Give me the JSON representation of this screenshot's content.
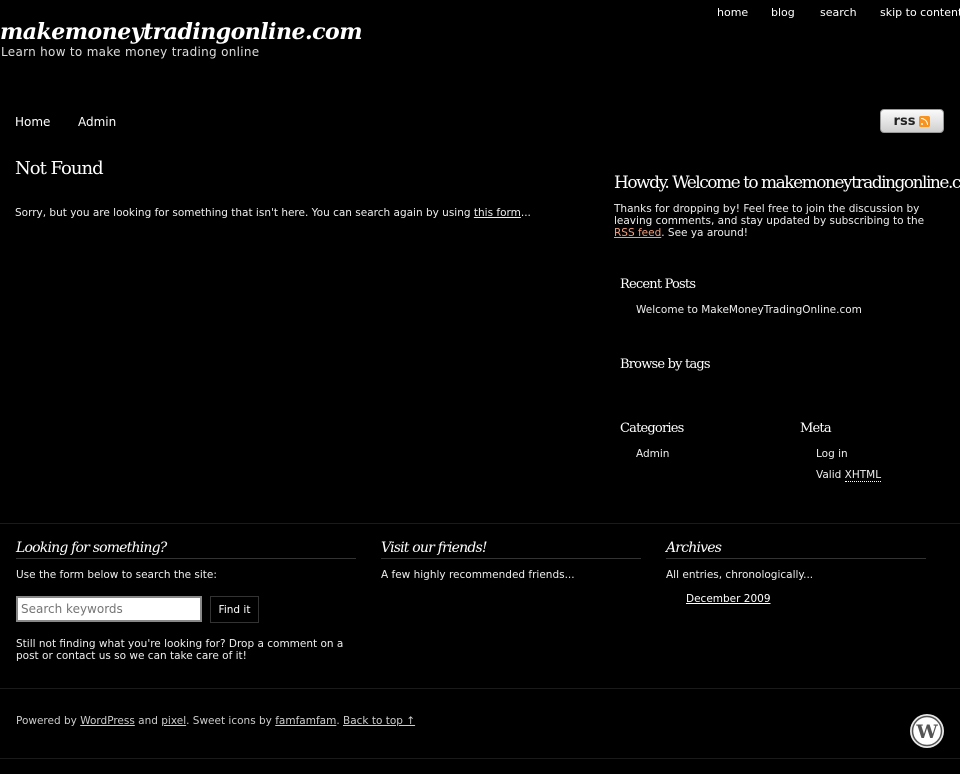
{
  "top_links": {
    "home": "home",
    "blog": "blog",
    "search": "search",
    "skip": "skip to content ↓"
  },
  "header": {
    "title": "makemoneytradingonline.com",
    "description": "Learn how to make money trading online"
  },
  "nav": {
    "home": "Home",
    "admin": "Admin",
    "rss_label": "rss"
  },
  "main": {
    "title": "Not Found",
    "text_before": "Sorry, but you are looking for something that isn't here. You can search again by using ",
    "link": "this form",
    "text_after": "..."
  },
  "sidebar": {
    "welcome_title": "Howdy. Welcome to makemoneytradingonline.com!",
    "intro_before": "Thanks for dropping by! Feel free to join the discussion by leaving comments, and stay updated by subscribing to the ",
    "intro_link": "RSS feed",
    "intro_after": ". See ya around!",
    "recent_posts_title": "Recent Posts",
    "recent_posts": [
      "Welcome to MakeMoneyTradingOnline.com"
    ],
    "tags_title": "Browse by tags",
    "categories_title": "Categories",
    "categories": [
      "Admin"
    ],
    "meta_title": "Meta",
    "meta_login": "Log in",
    "meta_valid": "Valid ",
    "meta_xhtml": "XHTML"
  },
  "footer_widgets": {
    "search_title": "Looking for something?",
    "search_intro": "Use the form below to search the site:",
    "search_placeholder": "Search keywords",
    "search_button": "Find it",
    "search_help": "Still not finding what you're looking for? Drop a comment on a post or contact us so we can take care of it!",
    "friends_title": "Visit our friends!",
    "friends_text": "A few highly recommended friends...",
    "archives_title": "Archives",
    "archives_text": "All entries, chronologically...",
    "archive_link": "December 2009"
  },
  "footer": {
    "powered_by": "Powered by ",
    "wordpress": "WordPress",
    "and": " and ",
    "pixel": "pixel",
    "icons": ". Sweet icons by ",
    "famfamfam": "famfamfam",
    "sep": ". ",
    "back_to_top": "Back to top ↑"
  },
  "colors": {
    "background": "#000000",
    "text": "#ffffff",
    "rss_link": "#f0a080"
  }
}
